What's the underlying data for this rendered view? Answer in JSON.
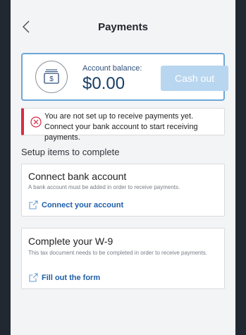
{
  "header": {
    "title": "Payments"
  },
  "balance": {
    "label": "Account balance:",
    "amount": "$0.00",
    "cashout_label": "Cash out"
  },
  "alert": {
    "message": "You are not set up to receive payments yet. Connect your bank account to start receiving payments."
  },
  "setup": {
    "title": "Setup items to complete",
    "items": [
      {
        "title": "Connect bank account",
        "description": "A bank account must be added in order to receive payments.",
        "link": "Connect your account"
      },
      {
        "title": "Complete your W-9",
        "description": "This tax document needs to be completed in order to receive payments.",
        "link": "Fill out the form"
      }
    ]
  },
  "colors": {
    "accent": "#1f5ea8",
    "error": "#d82b44",
    "cashout_disabled": "#b8d6ef",
    "frame": "#222831"
  }
}
